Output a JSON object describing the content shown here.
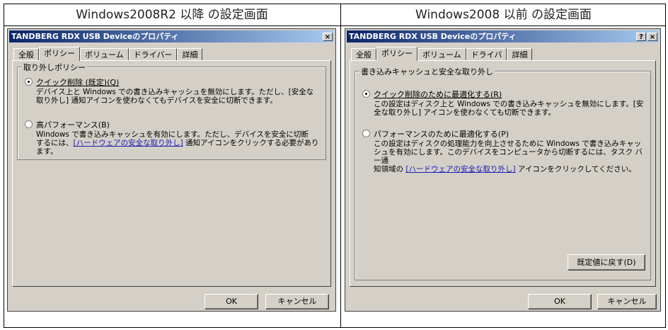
{
  "headers": {
    "left": "Windows2008R2 以降 の設定画面",
    "right": "Windows2008 以前 の設定画面"
  },
  "left_dialog": {
    "title": "TANDBERG RDX USB Deviceのプロパティ",
    "close": "×",
    "tabs": [
      "全般",
      "ポリシー",
      "ボリューム",
      "ドライバー",
      "詳細"
    ],
    "group_label": "取り外しポリシー",
    "option1": {
      "label": "クイック削除 (既定)(Q)",
      "desc_l1": "デバイス上と Windows での書き込みキャッシュを無効にします。ただし、[安全な",
      "desc_l2a": "取り外し]",
      "desc_l2b": " 通知アイコンを使わなくてもデバイスを安全に切断できます。"
    },
    "option2": {
      "label": "高パフォーマンス(B)",
      "desc_l1": "Windows で書き込みキャッシュを有効にします。ただし、デバイスを安全に切断",
      "desc_l2a": "するには、",
      "desc_l2link": "[ハードウェアの安全な取り外し]",
      "desc_l2b": " 通知アイコンをクリックする必要があり",
      "desc_l3": "ます。"
    },
    "ok": "OK",
    "cancel": "キャンセル"
  },
  "right_dialog": {
    "title": "TANDBERG RDX USB Deviceのプロパティ",
    "help": "?",
    "close": "×",
    "tabs": [
      "全般",
      "ポリシー",
      "ボリューム",
      "ドライバ",
      "詳細"
    ],
    "group_label": "書き込みキャッシュと安全な取り外し",
    "option1": {
      "label": "クイック削除のために最適化する(R)",
      "desc_l1": "この設定はディスク上と Windows での書き込みキャッシュを無効にします。[安",
      "desc_l2": "全な取り外し] アイコンを使わなくても切断できます。"
    },
    "option2": {
      "label": "パフォーマンスのために最適化する(P)",
      "desc_l1": "この設定はディスクの処理能力を向上させるために Windows で書き込みキャッ",
      "desc_l2": "シュを有効にします。このデバイスをコンピュータから切断するには、タスク バー通",
      "desc_l3a": "知領域の ",
      "desc_l3link": "[ハードウェアの安全な取り外し]",
      "desc_l3b": " アイコンをクリックしてください。"
    },
    "restore": "既定値に戻す(D)",
    "ok": "OK",
    "cancel": "キャンセル"
  }
}
